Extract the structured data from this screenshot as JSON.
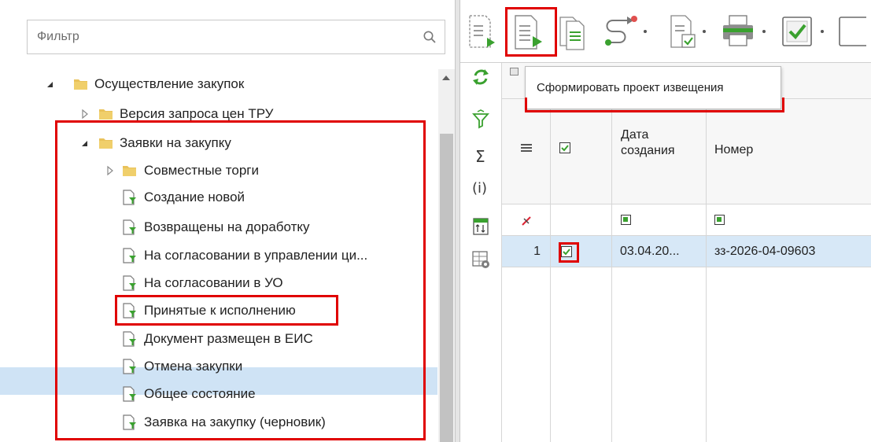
{
  "filter": {
    "placeholder": "Фильтр"
  },
  "tree": {
    "items": [
      {
        "label": "Осуществление закупок"
      },
      {
        "label": "Версия запроса цен ТРУ"
      },
      {
        "label": "Заявки на закупку"
      },
      {
        "label": "Совместные торги"
      },
      {
        "label": "Создание новой"
      },
      {
        "label": "Возвращены на доработку"
      },
      {
        "label": "На согласовании в управлении ци..."
      },
      {
        "label": "На согласовании в УО"
      },
      {
        "label": "Принятые к исполнению"
      },
      {
        "label": "Документ размещен в ЕИС"
      },
      {
        "label": "Отмена закупки"
      },
      {
        "label": "Общее состояние"
      },
      {
        "label": "Заявка на закупку (черновик)"
      }
    ]
  },
  "tooltip": {
    "text": "Сформировать проект извещения"
  },
  "grid": {
    "columns": [
      {
        "label": "Дата\nсоздания"
      },
      {
        "label": "Номер"
      }
    ],
    "rows": [
      {
        "num": "1",
        "date": "03.04.20...",
        "number": "зз-2026-04-09603"
      }
    ]
  },
  "colors": {
    "accent_green": "#3aa12f",
    "highlight_red": "#e00000",
    "selection_blue": "#cfe3f5",
    "folder_yellow": "#e9c25a"
  }
}
